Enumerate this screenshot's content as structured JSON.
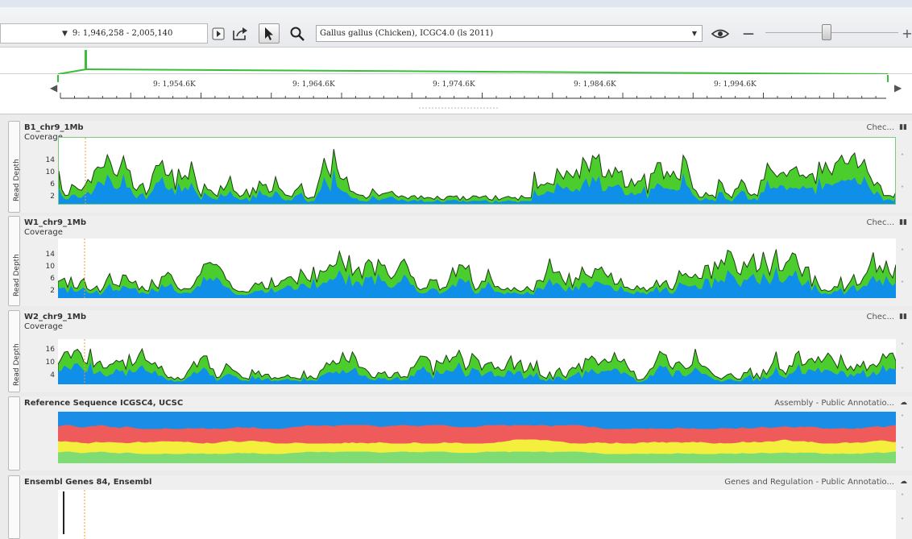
{
  "toolbar": {
    "locus_caret": "▼",
    "locus": "9: 1,946,258 - 2,005,140",
    "genome": "Gallus gallus (Chicken), ICGC4.0 (ls 2011)",
    "genome_caret": "▼",
    "zoom_minus": "—",
    "zoom_plus": "+",
    "zoom_level": 0.5
  },
  "ruler": {
    "ticks": [
      "9: 1,954.6K",
      "9: 1,964.6K",
      "9: 1,974.6K",
      "9: 1,984.6K",
      "9: 1,994.6K"
    ],
    "left_arrow": "◀",
    "right_arrow": "▶"
  },
  "colors": {
    "coverage_top": "#4ccd2e",
    "coverage_base": "#0f8fe8",
    "ref_a": "#1a8ee6",
    "ref_b": "#ef5a5a",
    "ref_c": "#f4ef3c",
    "ref_d": "#7fdc74"
  },
  "tracks": [
    {
      "title": "B1_chr9_1Mb",
      "subtitle": "Coverage",
      "right": "Chec...",
      "ylabel": "Read Depth",
      "yticks": [
        "14",
        "10",
        "6",
        "2"
      ]
    },
    {
      "title": "W1_chr9_1Mb",
      "subtitle": "Coverage",
      "right": "Chec...",
      "ylabel": "Read Depth",
      "yticks": [
        "14",
        "10",
        "6",
        "2"
      ]
    },
    {
      "title": "W2_chr9_1Mb",
      "subtitle": "Coverage",
      "right": "Chec...",
      "ylabel": "Read Depth",
      "yticks": [
        "16",
        "10",
        "4"
      ]
    },
    {
      "title": "Reference Sequence ICGSC4, UCSC",
      "right": "Assembly - Public Annotatio..."
    },
    {
      "title": "Ensembl Genes 84, Ensembl",
      "right": "Genes and Regulation - Public Annotatio..."
    }
  ]
}
